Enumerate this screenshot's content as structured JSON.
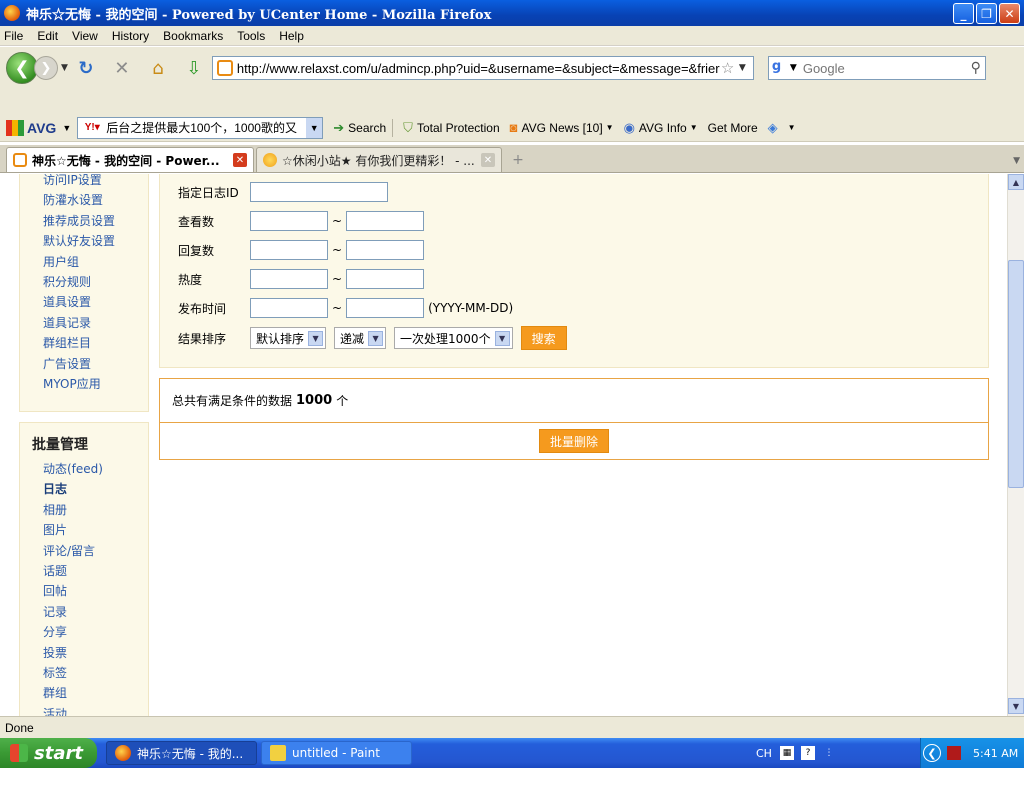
{
  "window": {
    "title": "神乐☆无悔 - 我的空间 - Powered by UCenter Home - Mozilla Firefox",
    "min": "_",
    "max": "❐",
    "close": "✕"
  },
  "menu": [
    "File",
    "Edit",
    "View",
    "History",
    "Bookmarks",
    "Tools",
    "Help"
  ],
  "nav": {
    "url": "http://www.relaxst.com/u/admincp.php?uid=&username=&subject=&message=&frier",
    "search_placeholder": "Google"
  },
  "avg_toolbar": {
    "logo": "AVG",
    "search_value": "后台之提供最大100个，1000歌的又",
    "search_label": "Search",
    "total_protection": "Total Protection",
    "news": "AVG News [10]",
    "info": "AVG Info",
    "get_more": "Get More"
  },
  "tabs": [
    {
      "title": "神乐☆无悔 - 我的空间 - Power..."
    },
    {
      "title": "☆休闲小站★ 有你我们更精彩！ - ..."
    }
  ],
  "sidebar": {
    "top_items": [
      "访问IP设置",
      "防灌水设置",
      "推荐成员设置",
      "默认好友设置",
      "用户组",
      "积分规则",
      "道具设置",
      "道具记录",
      "群组栏目",
      "广告设置",
      "MYOP应用"
    ],
    "batch_title": "批量管理",
    "batch_items": [
      "动态(feed)",
      "日志",
      "相册",
      "图片",
      "评论/留言",
      "话题",
      "回帖",
      "记录",
      "分享",
      "投票",
      "标签",
      "群组",
      "活动"
    ]
  },
  "search_form": {
    "blog_id_label": "指定日志ID",
    "views_label": "查看数",
    "replies_label": "回复数",
    "hot_label": "热度",
    "date_label": "发布时间",
    "date_hint": "(YYYY-MM-DD)",
    "sort_label": "结果排序",
    "sort_value": "默认排序",
    "order_value": "递减",
    "batch_value": "一次处理1000个",
    "search_button": "搜索",
    "tilde": "~"
  },
  "result": {
    "prefix": "总共有满足条件的数据",
    "count": "1000",
    "suffix": "个",
    "batch_delete": "批量删除"
  },
  "status": "Done",
  "taskbar": {
    "start": "start",
    "task1": "神乐☆无悔 - 我的...",
    "task2": "untitled - Paint",
    "lang": "CH",
    "clock": "5:41 AM"
  }
}
